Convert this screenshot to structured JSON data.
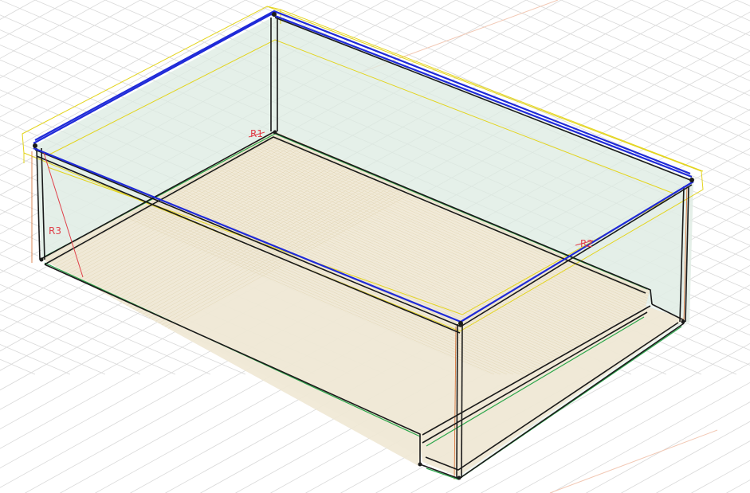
{
  "colors": {
    "background": "#ffffff",
    "grid": "#d9d9d9",
    "axis": "#f2b8a0",
    "glass_fill": "#dcebe2",
    "floor_fill": "#efe8d4",
    "frame_dark": "#1a1a1a",
    "frame_blue": "#1f2ad8",
    "frame_yellow": "#e3d41d",
    "frame_green": "#2aa64a",
    "frame_orange": "#d66a2c",
    "dimension_red": "#e0404a"
  },
  "labels": {
    "r1": "R1",
    "r2": "R2",
    "r3": "R3"
  }
}
